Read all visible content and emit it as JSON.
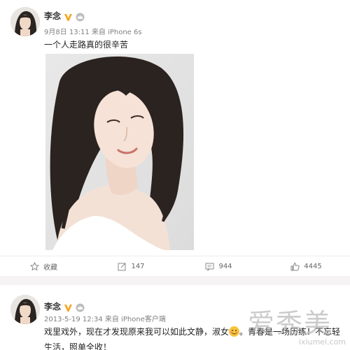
{
  "post1": {
    "author": "李念",
    "meta": "9月8日 13:11 来自 iPhone 6s",
    "text": "一个人走路真的很辛苦",
    "actions": {
      "favorite": "收藏",
      "repost": "147",
      "comment": "944",
      "like": "4445"
    }
  },
  "post2": {
    "author": "李念",
    "meta": "2013-5-19 12:34 来自 iPhone客户端",
    "text_line1_a": "戏里戏外，现在才发现原来我可以如此文静，淑女",
    "text_line1_b": "。青春是一场历练！不忘轻",
    "text_line2": "生活，照单全收！"
  },
  "watermark": {
    "brand": "爱秀美",
    "url": "ixiumei.com"
  },
  "colors": {
    "vip_badge": "#f5a623",
    "divider": "#f6f3f4",
    "meta": "#808080"
  }
}
